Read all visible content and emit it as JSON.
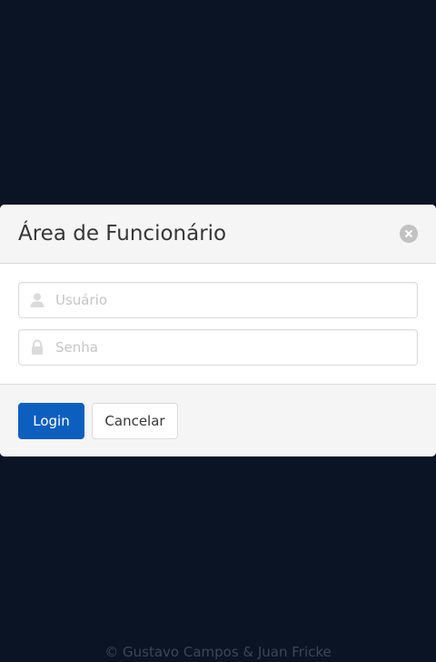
{
  "modal": {
    "title": "Área de Funcionário",
    "close_icon": "close-icon"
  },
  "form": {
    "username": {
      "placeholder": "Usuário",
      "value": "",
      "icon": "user-icon"
    },
    "password": {
      "placeholder": "Senha",
      "value": "",
      "icon": "lock-icon"
    }
  },
  "actions": {
    "login_label": "Login",
    "cancel_label": "Cancelar"
  },
  "footer": {
    "text": "© Gustavo Campos & Juan Fricke"
  },
  "colors": {
    "backdrop": "#0a1424",
    "primary": "#0d5fbf",
    "modal_bg": "#f5f5f5"
  }
}
